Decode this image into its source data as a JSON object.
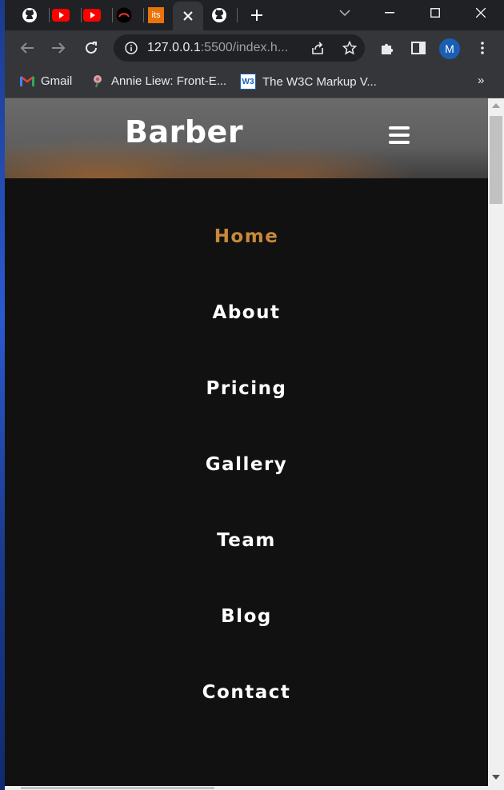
{
  "browser": {
    "url_host": "127.0.0.1",
    "url_rest": ":5500/index.h...",
    "profile_initial": "M",
    "tabs": [
      {
        "icon": "github-icon"
      },
      {
        "icon": "youtube-icon"
      },
      {
        "icon": "youtube-icon"
      },
      {
        "icon": "site-logo-icon"
      },
      {
        "icon": "its-icon",
        "label": "its"
      },
      {
        "icon": "close-icon",
        "active": true
      },
      {
        "icon": "github-icon"
      }
    ],
    "bookmarks": [
      {
        "label": "Gmail",
        "icon": "gmail-icon"
      },
      {
        "label": "Annie Liew: Front-E...",
        "icon": "rose-icon"
      },
      {
        "label": "The W3C Markup V...",
        "icon": "w3c-icon"
      }
    ],
    "bookmarks_overflow": "»"
  },
  "site": {
    "brand": "Barber",
    "nav": [
      {
        "label": "Home",
        "active": true
      },
      {
        "label": "About"
      },
      {
        "label": "Pricing"
      },
      {
        "label": "Gallery"
      },
      {
        "label": "Team"
      },
      {
        "label": "Blog"
      },
      {
        "label": "Contact"
      }
    ]
  },
  "colors": {
    "accent": "#c8893a",
    "menu_bg": "#111111",
    "chrome_bg": "#202124",
    "toolbar_bg": "#35363a"
  }
}
